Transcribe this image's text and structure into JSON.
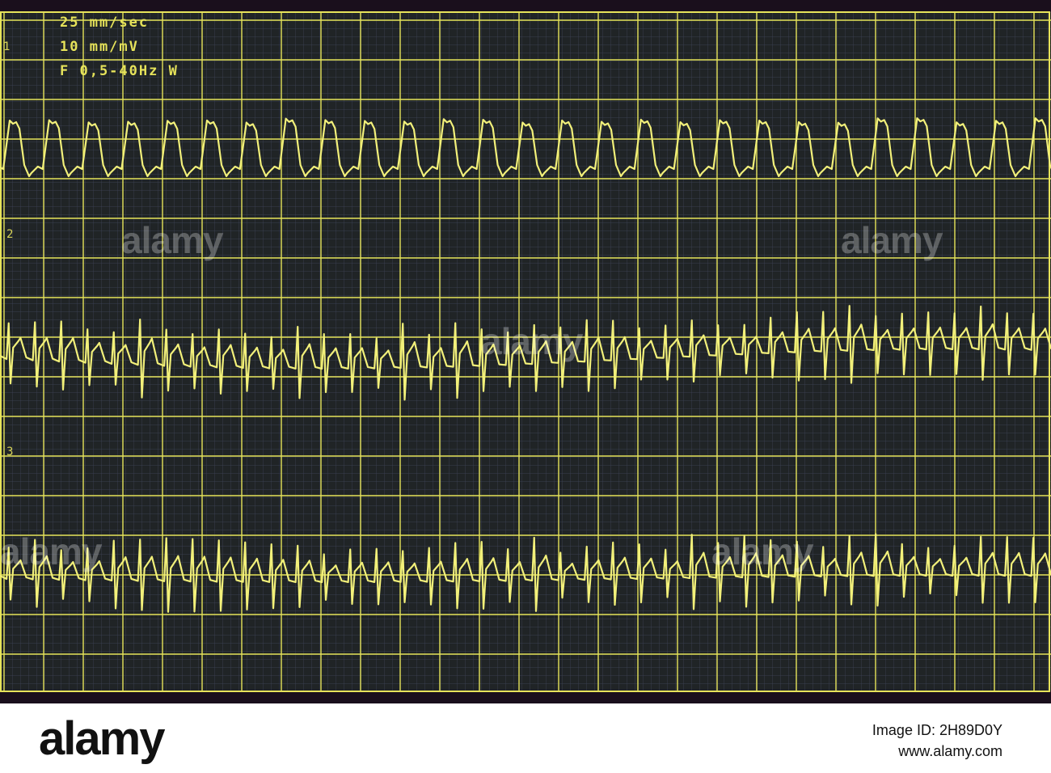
{
  "header": {
    "speed": "25 mm/sec",
    "gain": "10 mm/mV",
    "filter": "F 0,5-40Hz W"
  },
  "leads": [
    {
      "label": "1"
    },
    {
      "label": "2"
    },
    {
      "label": "3"
    }
  ],
  "watermark": "alamy",
  "footer": {
    "logo": "alamy",
    "image_id": "Image ID: 2H89D0Y",
    "site": "www.alamy.com"
  },
  "colors": {
    "background": "#1a0f1c",
    "grid": "#e6e35a",
    "trace": "#f2f07a",
    "fine_grid": "#3a3f55"
  }
}
